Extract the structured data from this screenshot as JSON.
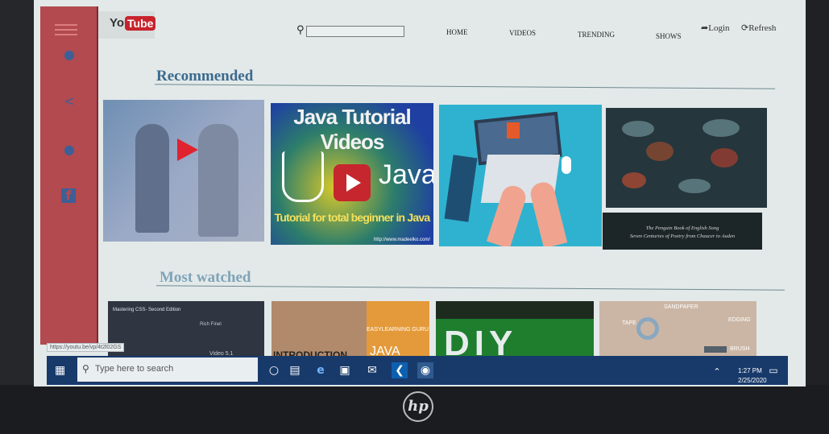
{
  "header": {
    "logo_you": "You",
    "logo_tube": "Tube",
    "search_placeholder": "",
    "nav": [
      "HOME",
      "VIDEOS",
      "TRENDING",
      "SHOWS"
    ],
    "login": "Login",
    "refresh": "Refresh"
  },
  "sections": {
    "recommended": "Recommended",
    "most_watched": "Most watched"
  },
  "thumbnails": {
    "java_title": "Java Tutorial Videos",
    "java_word": "Java",
    "java_sub": "Tutorial for total beginner in Java",
    "java_url": "http://www.madeelko.com/",
    "book_line1": "The Penguin Book of English Song",
    "book_line2": "Seven Centuries of Poetry from Chaucer to Auden",
    "css_title": "Mastering CSS- Second Edition",
    "css_sub": "Rich Finel",
    "css_badge": "Video 5.1",
    "easy_learning": "EASYLEARNING GURU",
    "java_big": "JAVA",
    "intro": "INTRODUCTION",
    "diy": "DIY",
    "tools": [
      "SANDPAPER",
      "TAPE",
      "EDGING",
      "BRUSH"
    ]
  },
  "status_url": "https://youtu.be/vp/4t2l02GS",
  "taskbar": {
    "search_placeholder": "Type here to search",
    "time": "1:27 PM",
    "date": "2/25/2020"
  },
  "device": {
    "brand": "hp"
  },
  "colors": {
    "sidebar": "#b24a4f",
    "accent_title": "#3b6a8e",
    "taskbar": "#183a6b",
    "youtube_red": "#c8232c"
  }
}
